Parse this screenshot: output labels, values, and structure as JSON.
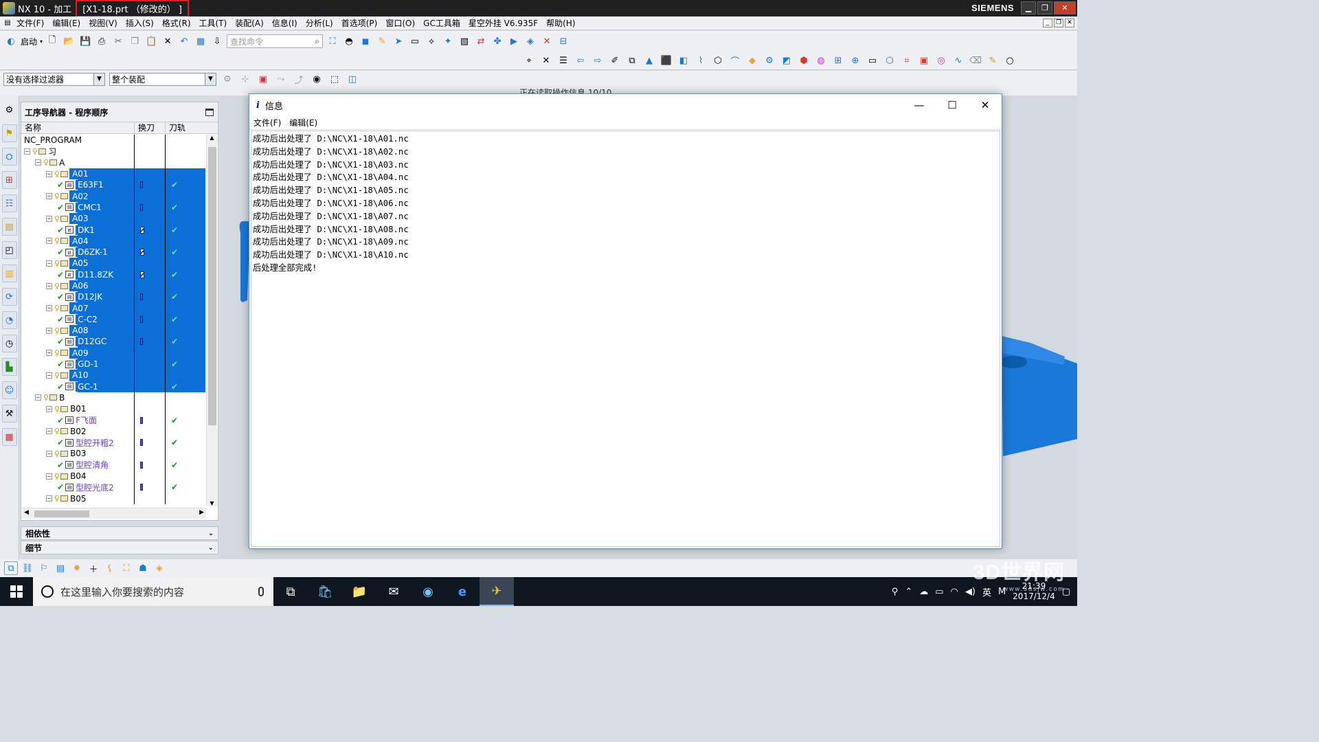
{
  "titlebar": {
    "app_title": "NX 10 - 加工",
    "doc_title": "[X1-18.prt （修改的） ]",
    "brand": "SIEMENS"
  },
  "menu": [
    "文件(F)",
    "编辑(E)",
    "视图(V)",
    "插入(S)",
    "格式(R)",
    "工具(T)",
    "装配(A)",
    "信息(I)",
    "分析(L)",
    "首选项(P)",
    "窗口(O)",
    "GC工具箱",
    "星空外挂 V6.935F",
    "帮助(H)"
  ],
  "toolbar": {
    "start_label": "启动",
    "search_placeholder": "查找命令"
  },
  "filters": {
    "selection_filter": "没有选择过滤器",
    "assembly_scope": "整个装配"
  },
  "status_strip": "正在读取操作信息 10/10",
  "navigator": {
    "title": "工序导航器 - 程序顺序",
    "columns": [
      "名称",
      "换刀",
      "刀轨"
    ],
    "root": "NC_PROGRAM",
    "rows": [
      {
        "label": "习",
        "level": 0,
        "type": "group"
      },
      {
        "label": "A",
        "level": 1,
        "type": "group"
      },
      {
        "label": "A01",
        "level": 2,
        "type": "group",
        "selected": true
      },
      {
        "label": "E63F1",
        "level": 3,
        "type": "op",
        "tool": "bar",
        "selected": true
      },
      {
        "label": "A02",
        "level": 2,
        "type": "group",
        "selected": true
      },
      {
        "label": "CMC1",
        "level": 3,
        "type": "op",
        "tool": "bar",
        "selected": true
      },
      {
        "label": "A03",
        "level": 2,
        "type": "group",
        "selected": true
      },
      {
        "label": "DK1",
        "level": 3,
        "type": "op",
        "tool": "z",
        "selected": true
      },
      {
        "label": "A04",
        "level": 2,
        "type": "group",
        "selected": true
      },
      {
        "label": "D6ZK-1",
        "level": 3,
        "type": "op",
        "tool": "z",
        "selected": true
      },
      {
        "label": "A05",
        "level": 2,
        "type": "group",
        "selected": true
      },
      {
        "label": "D11.8ZK",
        "level": 3,
        "type": "op",
        "tool": "z",
        "selected": true
      },
      {
        "label": "A06",
        "level": 2,
        "type": "group",
        "selected": true
      },
      {
        "label": "D12JK",
        "level": 3,
        "type": "op",
        "tool": "bar",
        "selected": true
      },
      {
        "label": "A07",
        "level": 2,
        "type": "group",
        "selected": true
      },
      {
        "label": "C-C2",
        "level": 3,
        "type": "op",
        "tool": "bar",
        "selected": true
      },
      {
        "label": "A08",
        "level": 2,
        "type": "group",
        "selected": true
      },
      {
        "label": "D12GC",
        "level": 3,
        "type": "op",
        "tool": "bar",
        "selected": true
      },
      {
        "label": "A09",
        "level": 2,
        "type": "group",
        "selected": true
      },
      {
        "label": "GD-1",
        "level": 3,
        "type": "op",
        "tool": "",
        "selected": true
      },
      {
        "label": "A10",
        "level": 2,
        "type": "group",
        "selected": true
      },
      {
        "label": "GC-1",
        "level": 3,
        "type": "op",
        "tool": "",
        "selected": true
      },
      {
        "label": "B",
        "level": 1,
        "type": "group"
      },
      {
        "label": "B01",
        "level": 2,
        "type": "group"
      },
      {
        "label": "F飞面",
        "level": 3,
        "type": "op",
        "tool": "bar",
        "purple": true
      },
      {
        "label": "B02",
        "level": 2,
        "type": "group"
      },
      {
        "label": "型腔开粗2",
        "level": 3,
        "type": "op",
        "tool": "bar",
        "purple": true
      },
      {
        "label": "B03",
        "level": 2,
        "type": "group"
      },
      {
        "label": "型腔清角",
        "level": 3,
        "type": "op",
        "tool": "bar",
        "purple": true
      },
      {
        "label": "B04",
        "level": 2,
        "type": "group"
      },
      {
        "label": "型腔光底2",
        "level": 3,
        "type": "op",
        "tool": "bar",
        "purple": true
      },
      {
        "label": "B05",
        "level": 2,
        "type": "group"
      }
    ]
  },
  "panels": {
    "dependency": "相依性",
    "details": "细节"
  },
  "info_window": {
    "title": "信息",
    "menu": [
      "文件(F)",
      "编辑(E)"
    ],
    "lines": [
      "成功后出处理了 D:\\NC\\X1-18\\A01.nc",
      "成功后出处理了 D:\\NC\\X1-18\\A02.nc",
      "成功后出处理了 D:\\NC\\X1-18\\A03.nc",
      "成功后出处理了 D:\\NC\\X1-18\\A04.nc",
      "成功后出处理了 D:\\NC\\X1-18\\A05.nc",
      "成功后出处理了 D:\\NC\\X1-18\\A06.nc",
      "成功后出处理了 D:\\NC\\X1-18\\A07.nc",
      "成功后出处理了 D:\\NC\\X1-18\\A08.nc",
      "成功后出处理了 D:\\NC\\X1-18\\A09.nc",
      "成功后出处理了 D:\\NC\\X1-18\\A10.nc",
      "后处理全部完成!"
    ]
  },
  "taskbar": {
    "search_placeholder": "在这里输入你要搜索的内容",
    "ime": "英",
    "time": "21:39",
    "date": "2017/12/4"
  },
  "watermark": {
    "text": "3D世界网",
    "url": "www.3dsjw.com"
  },
  "colors": {
    "selection": "#0a6fd6",
    "part_blue": "#1a78d8",
    "highlight_box": "#e31b1b"
  }
}
